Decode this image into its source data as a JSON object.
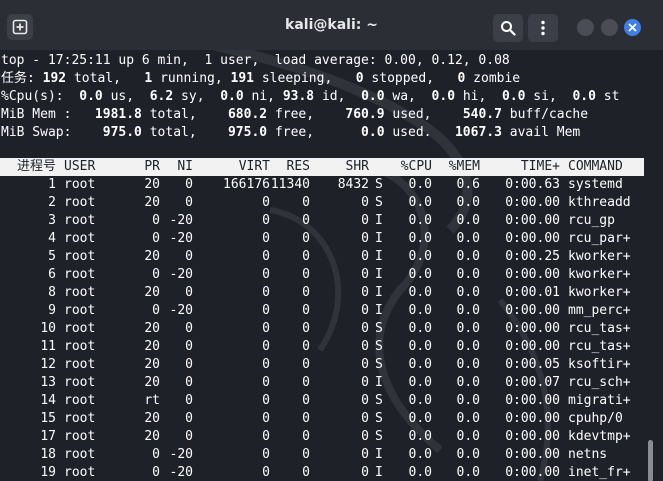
{
  "window": {
    "title": "kali@kali: ~",
    "new_tab_icon": "new-tab-icon",
    "search_icon": "search-icon",
    "menu_icon": "kebab-menu-icon",
    "close_icon": "close-icon",
    "accent": "#3f7fe8"
  },
  "summary": [
    {
      "parts": [
        {
          "t": "top - 17:25:11 up 6 min,  1 user,  load average: 0.00, 0.12, 0.08",
          "b": false
        }
      ]
    },
    {
      "parts": [
        {
          "t": "任务:",
          "b": false
        },
        {
          "t": " 192",
          "b": true
        },
        {
          "t": " total,   ",
          "b": false
        },
        {
          "t": "1",
          "b": true
        },
        {
          "t": " running, ",
          "b": false
        },
        {
          "t": "191",
          "b": true
        },
        {
          "t": " sleeping,   ",
          "b": false
        },
        {
          "t": "0",
          "b": true
        },
        {
          "t": " stopped,   ",
          "b": false
        },
        {
          "t": "0",
          "b": true
        },
        {
          "t": " zombie",
          "b": false
        }
      ]
    },
    {
      "parts": [
        {
          "t": "%Cpu(s):  ",
          "b": false
        },
        {
          "t": "0.0",
          "b": true
        },
        {
          "t": " us,  ",
          "b": false
        },
        {
          "t": "6.2",
          "b": true
        },
        {
          "t": " sy,  ",
          "b": false
        },
        {
          "t": "0.0",
          "b": true
        },
        {
          "t": " ni, ",
          "b": false
        },
        {
          "t": "93.8",
          "b": true
        },
        {
          "t": " id,  ",
          "b": false
        },
        {
          "t": "0.0",
          "b": true
        },
        {
          "t": " wa,  ",
          "b": false
        },
        {
          "t": "0.0",
          "b": true
        },
        {
          "t": " hi,  ",
          "b": false
        },
        {
          "t": "0.0",
          "b": true
        },
        {
          "t": " si,  ",
          "b": false
        },
        {
          "t": "0.0",
          "b": true
        },
        {
          "t": " st",
          "b": false
        }
      ]
    },
    {
      "parts": [
        {
          "t": "MiB Mem :  ",
          "b": false
        },
        {
          "t": " 1981.8",
          "b": true
        },
        {
          "t": " total,    ",
          "b": false
        },
        {
          "t": "680.2",
          "b": true
        },
        {
          "t": " free,    ",
          "b": false
        },
        {
          "t": "760.9",
          "b": true
        },
        {
          "t": " used,    ",
          "b": false
        },
        {
          "t": "540.7",
          "b": true
        },
        {
          "t": " buff/cache",
          "b": false
        }
      ]
    },
    {
      "parts": [
        {
          "t": "MiB Swap:  ",
          "b": false
        },
        {
          "t": "  975.0",
          "b": true
        },
        {
          "t": " total,    ",
          "b": false
        },
        {
          "t": "975.0",
          "b": true
        },
        {
          "t": " free,      ",
          "b": false
        },
        {
          "t": "0.0",
          "b": true
        },
        {
          "t": " used.   ",
          "b": false
        },
        {
          "t": "1067.3",
          "b": true
        },
        {
          "t": " avail Mem",
          "b": false
        }
      ]
    }
  ],
  "table": {
    "columns": [
      "进程号",
      "USER",
      "PR",
      "NI",
      "VIRT",
      "RES",
      "SHR",
      "",
      "%CPU",
      "%MEM",
      "TIME+",
      "COMMAND"
    ],
    "rows": [
      [
        "1",
        "root",
        "20",
        "0",
        "166176",
        "11340",
        "8432",
        "S",
        "0.0",
        "0.6",
        "0:00.63",
        "systemd"
      ],
      [
        "2",
        "root",
        "20",
        "0",
        "0",
        "0",
        "0",
        "S",
        "0.0",
        "0.0",
        "0:00.00",
        "kthreadd"
      ],
      [
        "3",
        "root",
        "0",
        "-20",
        "0",
        "0",
        "0",
        "I",
        "0.0",
        "0.0",
        "0:00.00",
        "rcu_gp"
      ],
      [
        "4",
        "root",
        "0",
        "-20",
        "0",
        "0",
        "0",
        "I",
        "0.0",
        "0.0",
        "0:00.00",
        "rcu_par+"
      ],
      [
        "5",
        "root",
        "20",
        "0",
        "0",
        "0",
        "0",
        "I",
        "0.0",
        "0.0",
        "0:00.25",
        "kworker+"
      ],
      [
        "6",
        "root",
        "0",
        "-20",
        "0",
        "0",
        "0",
        "I",
        "0.0",
        "0.0",
        "0:00.00",
        "kworker+"
      ],
      [
        "8",
        "root",
        "20",
        "0",
        "0",
        "0",
        "0",
        "I",
        "0.0",
        "0.0",
        "0:00.01",
        "kworker+"
      ],
      [
        "9",
        "root",
        "0",
        "-20",
        "0",
        "0",
        "0",
        "I",
        "0.0",
        "0.0",
        "0:00.00",
        "mm_perc+"
      ],
      [
        "10",
        "root",
        "20",
        "0",
        "0",
        "0",
        "0",
        "S",
        "0.0",
        "0.0",
        "0:00.00",
        "rcu_tas+"
      ],
      [
        "11",
        "root",
        "20",
        "0",
        "0",
        "0",
        "0",
        "S",
        "0.0",
        "0.0",
        "0:00.00",
        "rcu_tas+"
      ],
      [
        "12",
        "root",
        "20",
        "0",
        "0",
        "0",
        "0",
        "S",
        "0.0",
        "0.0",
        "0:00.05",
        "ksoftir+"
      ],
      [
        "13",
        "root",
        "20",
        "0",
        "0",
        "0",
        "0",
        "I",
        "0.0",
        "0.0",
        "0:00.07",
        "rcu_sch+"
      ],
      [
        "14",
        "root",
        "rt",
        "0",
        "0",
        "0",
        "0",
        "S",
        "0.0",
        "0.0",
        "0:00.00",
        "migrati+"
      ],
      [
        "15",
        "root",
        "20",
        "0",
        "0",
        "0",
        "0",
        "S",
        "0.0",
        "0.0",
        "0:00.00",
        "cpuhp/0"
      ],
      [
        "17",
        "root",
        "20",
        "0",
        "0",
        "0",
        "0",
        "S",
        "0.0",
        "0.0",
        "0:00.00",
        "kdevtmp+"
      ],
      [
        "18",
        "root",
        "0",
        "-20",
        "0",
        "0",
        "0",
        "I",
        "0.0",
        "0.0",
        "0:00.00",
        "netns"
      ],
      [
        "19",
        "root",
        "0",
        "-20",
        "0",
        "0",
        "0",
        "I",
        "0.0",
        "0.0",
        "0:00.00",
        "inet_fr+"
      ]
    ]
  }
}
